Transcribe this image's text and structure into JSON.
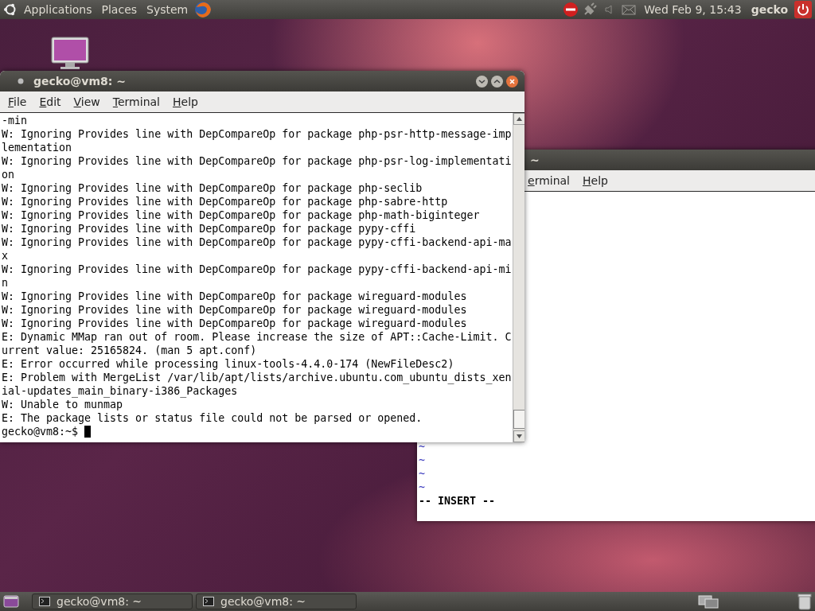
{
  "top_panel": {
    "menus": [
      "Applications",
      "Places",
      "System"
    ],
    "clock": "Wed Feb  9, 15:43",
    "user": "gecko"
  },
  "back_window": {
    "title": "~",
    "menus": [
      "erminal",
      "Help"
    ],
    "vim_lines": [
      "~",
      "~",
      "~",
      "~"
    ],
    "status": "-- INSERT --"
  },
  "terminal": {
    "title": "gecko@vm8: ~",
    "menus": [
      "File",
      "Edit",
      "View",
      "Terminal",
      "Help"
    ],
    "lines": [
      "-min",
      "W: Ignoring Provides line with DepCompareOp for package php-psr-http-message-imp",
      "lementation",
      "W: Ignoring Provides line with DepCompareOp for package php-psr-log-implementati",
      "on",
      "W: Ignoring Provides line with DepCompareOp for package php-seclib",
      "W: Ignoring Provides line with DepCompareOp for package php-sabre-http",
      "W: Ignoring Provides line with DepCompareOp for package php-math-biginteger",
      "W: Ignoring Provides line with DepCompareOp for package pypy-cffi",
      "W: Ignoring Provides line with DepCompareOp for package pypy-cffi-backend-api-ma",
      "x",
      "W: Ignoring Provides line with DepCompareOp for package pypy-cffi-backend-api-mi",
      "n",
      "W: Ignoring Provides line with DepCompareOp for package wireguard-modules",
      "W: Ignoring Provides line with DepCompareOp for package wireguard-modules",
      "W: Ignoring Provides line with DepCompareOp for package wireguard-modules",
      "E: Dynamic MMap ran out of room. Please increase the size of APT::Cache-Limit. C",
      "urrent value: 25165824. (man 5 apt.conf)",
      "E: Error occurred while processing linux-tools-4.4.0-174 (NewFileDesc2)",
      "E: Problem with MergeList /var/lib/apt/lists/archive.ubuntu.com_ubuntu_dists_xen",
      "ial-updates_main_binary-i386_Packages",
      "W: Unable to munmap",
      "E: The package lists or status file could not be parsed or opened."
    ],
    "prompt": "gecko@vm8:~$"
  },
  "taskbar": {
    "items": [
      "gecko@vm8: ~",
      "gecko@vm8: ~"
    ]
  }
}
